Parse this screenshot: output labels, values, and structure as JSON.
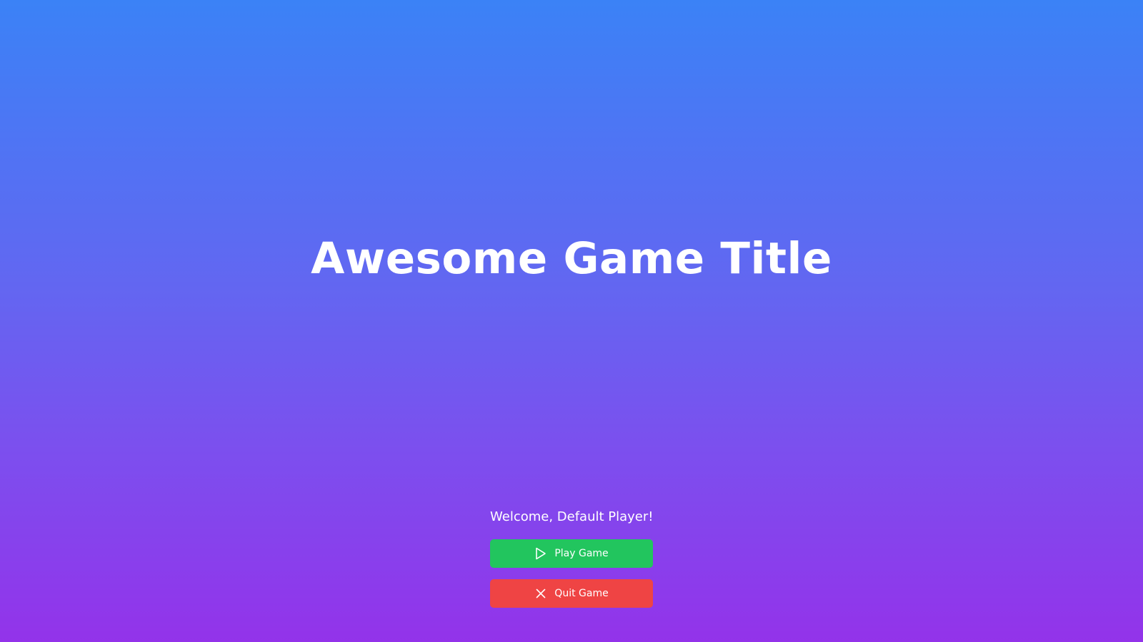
{
  "title": "Awesome Game Title",
  "welcome_text": "Welcome, Default Player!",
  "buttons": {
    "play": {
      "label": "Play Game",
      "icon": "play-icon",
      "color": "#22c55e"
    },
    "quit": {
      "label": "Quit Game",
      "icon": "close-icon",
      "color": "#ef4444"
    }
  },
  "colors": {
    "background_top": "#3b82f6",
    "background_bottom": "#9333ea",
    "text": "#ffffff"
  }
}
